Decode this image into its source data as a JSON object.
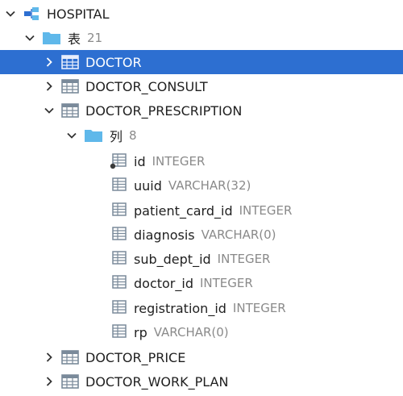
{
  "colors": {
    "accent": "#2d6fd1",
    "folder": "#5fb8ea",
    "table_icon": "#7a8a9a",
    "type_text": "#8a8a8a"
  },
  "tree": {
    "schema": {
      "label": "HOSPITAL",
      "icon": "schema-icon",
      "expanded": true
    },
    "tables_folder": {
      "label": "表",
      "count": "21",
      "icon": "folder-icon",
      "expanded": true
    },
    "tables": [
      {
        "label": "DOCTOR",
        "icon": "table-icon",
        "expanded": false,
        "selected": true
      },
      {
        "label": "DOCTOR_CONSULT",
        "icon": "table-icon",
        "expanded": false,
        "selected": false
      },
      {
        "label": "DOCTOR_PRESCRIPTION",
        "icon": "table-icon",
        "expanded": true,
        "selected": false
      }
    ],
    "columns_folder": {
      "label": "列",
      "count": "8",
      "icon": "folder-icon",
      "expanded": true
    },
    "columns": [
      {
        "name": "id",
        "type": "INTEGER",
        "icon": "primary-key-column-icon"
      },
      {
        "name": "uuid",
        "type": "VARCHAR(32)",
        "icon": "column-icon"
      },
      {
        "name": "patient_card_id",
        "type": "INTEGER",
        "icon": "column-icon"
      },
      {
        "name": "diagnosis",
        "type": "VARCHAR(0)",
        "icon": "column-icon"
      },
      {
        "name": "sub_dept_id",
        "type": "INTEGER",
        "icon": "column-icon"
      },
      {
        "name": "doctor_id",
        "type": "INTEGER",
        "icon": "column-icon"
      },
      {
        "name": "registration_id",
        "type": "INTEGER",
        "icon": "column-icon"
      },
      {
        "name": "rp",
        "type": "VARCHAR(0)",
        "icon": "column-icon"
      }
    ],
    "more_tables": [
      {
        "label": "DOCTOR_PRICE",
        "icon": "table-icon",
        "expanded": false
      },
      {
        "label": "DOCTOR_WORK_PLAN",
        "icon": "table-icon",
        "expanded": false
      }
    ]
  }
}
